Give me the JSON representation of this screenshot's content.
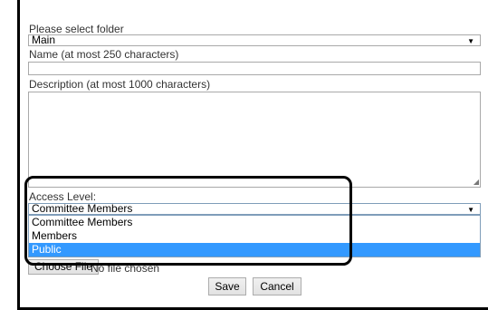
{
  "form": {
    "folder": {
      "label": "Please select folder",
      "selected": "Main"
    },
    "name": {
      "label": "Name (at most 250 characters)",
      "value": ""
    },
    "description": {
      "label": "Description (at most 1000 characters)",
      "value": ""
    },
    "access_level": {
      "label": "Access Level:",
      "selected": "Committee Members",
      "options": [
        "Committee Members",
        "Members",
        "Public"
      ],
      "highlighted": "Public"
    },
    "file": {
      "button_label": "Choose File",
      "status": "No file chosen"
    },
    "actions": {
      "save_label": "Save",
      "cancel_label": "Cancel"
    }
  },
  "colors": {
    "highlight": "#3399ff",
    "border": "#a9a9a9",
    "callout": "#000000"
  }
}
